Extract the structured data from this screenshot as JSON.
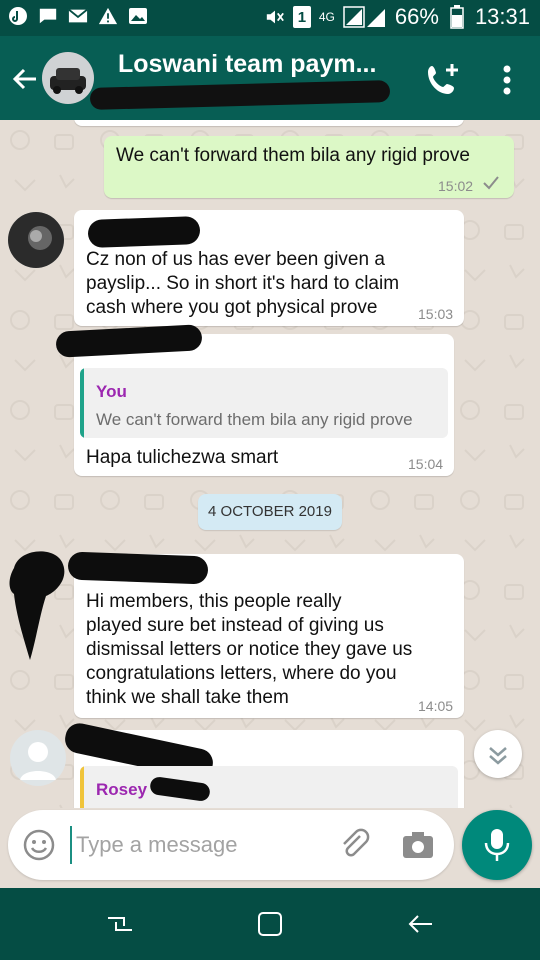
{
  "status_bar": {
    "battery": "66%",
    "time": "13:31",
    "network": "4G",
    "sim_slot": "1",
    "icons": [
      "tiktok-icon",
      "message-icon",
      "gmail-icon",
      "warning-icon",
      "gallery-icon",
      "mute-icon",
      "signal-icon",
      "battery-icon"
    ]
  },
  "header": {
    "title": "Loswani team paym..."
  },
  "messages": [
    {
      "type": "out",
      "text": "We can't  forward them bila any rigid  prove",
      "time": "15:02",
      "status": "read-check"
    },
    {
      "type": "in",
      "lines": [
        "Cz non of us has ever been given a",
        "payslip... So in short it's hard to claim",
        "cash where you got physical prove"
      ],
      "time": "15:03"
    },
    {
      "type": "in",
      "quote_author": "You",
      "quote_text": "We can't  forward them bila any rigid  prove",
      "text": "Hapa tulichezwa smart",
      "time": "15:04"
    },
    {
      "type": "in",
      "lines": [
        "Hi members, this people really",
        "played sure bet instead of giving us",
        "dismissal letters or notice they gave us",
        "congratulations letters, where do you",
        "think we shall take them"
      ],
      "time": "14:05"
    },
    {
      "type": "in",
      "quote_author": "Rosey"
    }
  ],
  "date_chip": "4 OCTOBER 2019",
  "input": {
    "placeholder": "Type a message"
  },
  "colors": {
    "header": "#075e54",
    "status_bar": "#054d44",
    "outgoing": "#dcf8c6",
    "accent": "#00897b",
    "quote_you": "#9c27b0",
    "quote_rosey": "#f0c43a"
  }
}
